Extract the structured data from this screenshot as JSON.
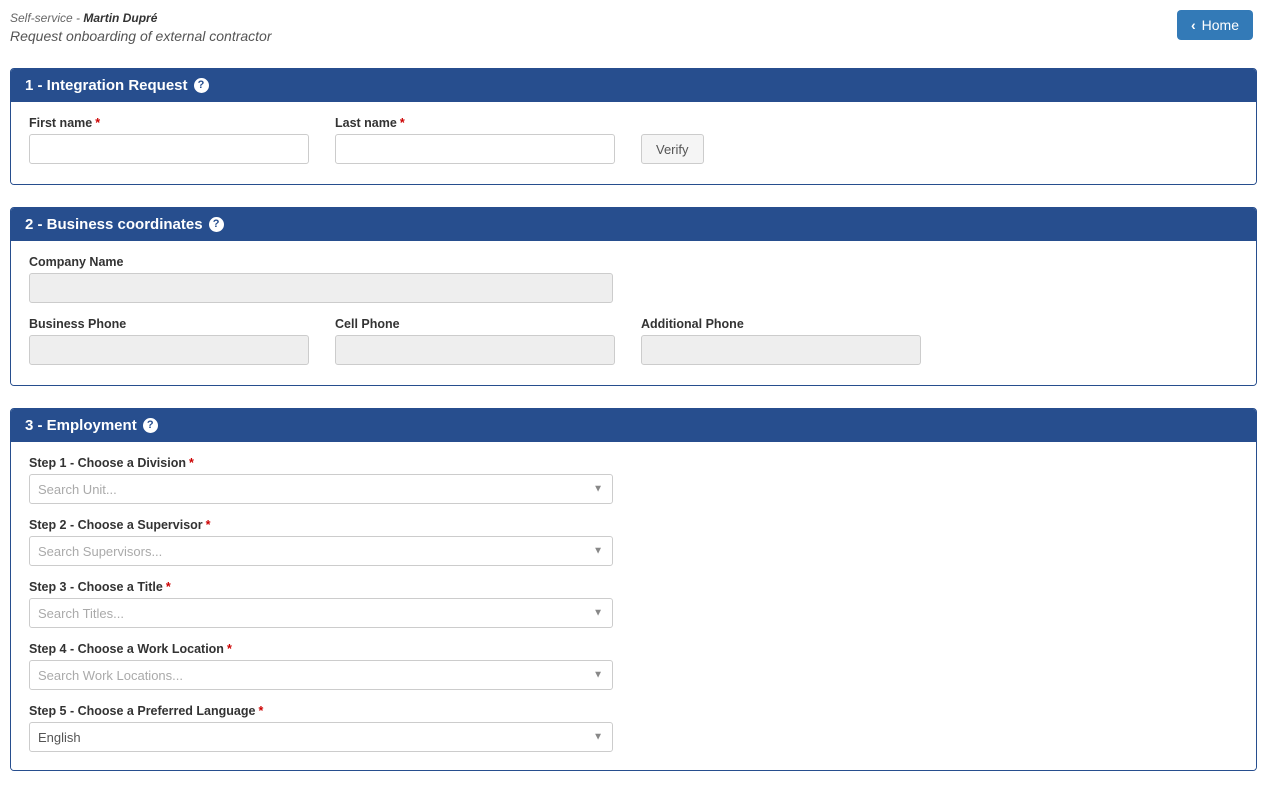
{
  "header": {
    "breadcrumb_prefix": "Self-service - ",
    "username": "Martin Dupré",
    "subtitle": "Request onboarding of external contractor",
    "home_label": "Home"
  },
  "section1": {
    "title": "1 - Integration Request",
    "first_name_label": "First name",
    "last_name_label": "Last name",
    "verify_label": "Verify"
  },
  "section2": {
    "title": "2 - Business coordinates",
    "company_label": "Company Name",
    "business_phone_label": "Business Phone",
    "cell_phone_label": "Cell Phone",
    "additional_phone_label": "Additional Phone"
  },
  "section3": {
    "title": "3 - Employment",
    "step1_label": "Step 1 - Choose a Division",
    "step1_placeholder": "Search Unit...",
    "step2_label": "Step 2 - Choose a Supervisor",
    "step2_placeholder": "Search Supervisors...",
    "step3_label": "Step 3 - Choose a Title",
    "step3_placeholder": "Search Titles...",
    "step4_label": "Step 4 - Choose a Work Location",
    "step4_placeholder": "Search Work Locations...",
    "step5_label": "Step 5 - Choose a Preferred Language",
    "step5_value": "English"
  }
}
